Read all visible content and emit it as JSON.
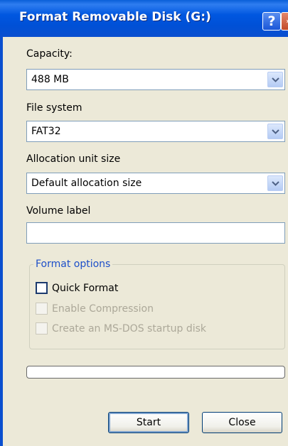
{
  "window": {
    "title": "Format Removable Disk (G:)",
    "help_glyph": "?",
    "accent_color": "#0a4fcf"
  },
  "capacity": {
    "label": "Capacity:",
    "value": "488 MB"
  },
  "file_system": {
    "label": "File system",
    "value": "FAT32"
  },
  "allocation": {
    "label": "Allocation unit size",
    "value": "Default allocation size"
  },
  "volume": {
    "label": "Volume label",
    "value": ""
  },
  "format_options": {
    "title": "Format options",
    "quick_format": {
      "label": "Quick Format",
      "checked": false,
      "enabled": true
    },
    "enable_compression": {
      "label": "Enable Compression",
      "checked": false,
      "enabled": false
    },
    "msdos_startup": {
      "label": "Create an MS-DOS startup disk",
      "checked": false,
      "enabled": false
    }
  },
  "progress": {
    "value": 0
  },
  "buttons": {
    "start": "Start",
    "close": "Close"
  }
}
